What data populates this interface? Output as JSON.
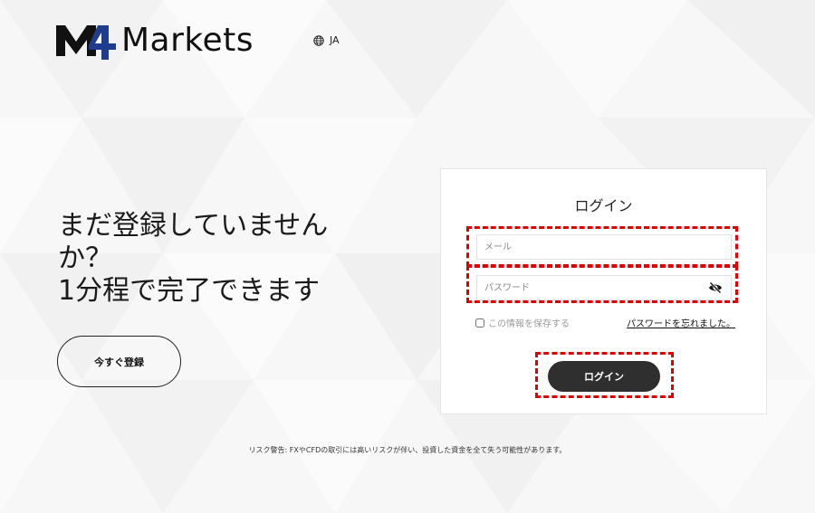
{
  "header": {
    "logo_text": "Markets",
    "logo_mark": "M4",
    "language": "JA",
    "language_icon": "globe-icon"
  },
  "promo": {
    "heading_line1": "まだ登録していません",
    "heading_line2": "か？",
    "heading_line3": "1分程で完了できます",
    "register_label": "今すぐ登録"
  },
  "login": {
    "title": "ログイン",
    "email_placeholder": "メール",
    "password_placeholder": "パスワード",
    "password_toggle_icon": "eye-off-icon",
    "remember_label": "この情報を保存する",
    "forgot_label": "パスワードを忘れました。",
    "submit_label": "ログイン"
  },
  "footer": {
    "risk_warning": "リスク警告: FXやCFDの取引には高いリスクが伴い、投資した資金を全て失う可能性があります。"
  },
  "colors": {
    "highlight": "#e00000",
    "button_dark": "#2f2f2f",
    "brand_blue": "#1f3c8f"
  }
}
